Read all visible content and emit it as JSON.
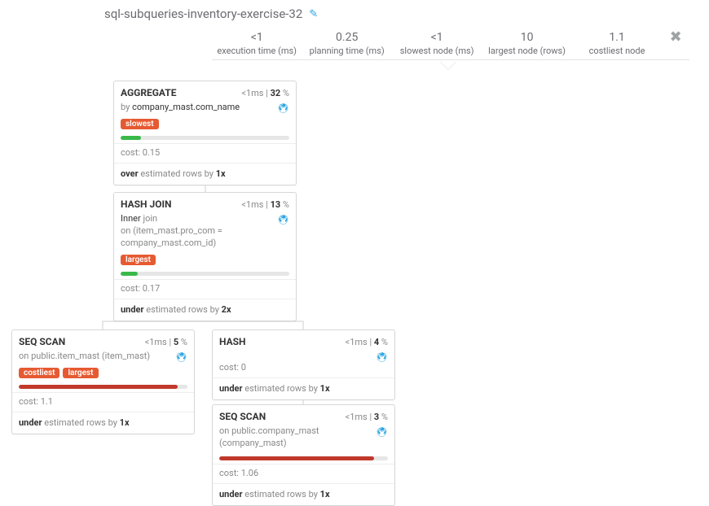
{
  "title": "sql-subqueries-inventory-exercise-32",
  "stats": [
    {
      "value": "<1",
      "label": "execution time (ms)"
    },
    {
      "value": "0.25",
      "label": "planning time (ms)"
    },
    {
      "value": "<1",
      "label": "slowest node (ms)"
    },
    {
      "value": "10",
      "label": "largest node (rows)"
    },
    {
      "value": "1.1",
      "label": "costliest node"
    }
  ],
  "nodes": {
    "aggregate": {
      "title": "AGGREGATE",
      "time": "<1ms",
      "pct": "32",
      "by_prefix": "by",
      "by_value": "company_mast.com_name",
      "badge_slowest": "slowest",
      "cost_label": "cost:",
      "cost": "0.15",
      "est_dir": "over",
      "est_text": "estimated rows by",
      "est_factor": "1x"
    },
    "hashjoin": {
      "title": "HASH JOIN",
      "time": "<1ms",
      "pct": "13",
      "join_kind": "Inner",
      "join_word": "join",
      "on_text": "on (item_mast.pro_com = company_mast.com_id)",
      "badge_largest": "largest",
      "cost_label": "cost:",
      "cost": "0.17",
      "est_dir": "under",
      "est_text": "estimated rows by",
      "est_factor": "2x"
    },
    "seqscan1": {
      "title": "SEQ SCAN",
      "time": "<1ms",
      "pct": "5",
      "on_text": "on public.item_mast (item_mast)",
      "badge_costliest": "costliest",
      "badge_largest": "largest",
      "cost_label": "cost:",
      "cost": "1.1",
      "est_dir": "under",
      "est_text": "estimated rows by",
      "est_factor": "1x"
    },
    "hash": {
      "title": "HASH",
      "time": "<1ms",
      "pct": "4",
      "cost_label": "cost:",
      "cost": "0",
      "est_dir": "under",
      "est_text": "estimated rows by",
      "est_factor": "1x"
    },
    "seqscan2": {
      "title": "SEQ SCAN",
      "time": "<1ms",
      "pct": "3",
      "on_text": "on public.company_mast (company_mast)",
      "cost_label": "cost:",
      "cost": "1.06",
      "est_dir": "under",
      "est_text": "estimated rows by",
      "est_factor": "1x"
    }
  }
}
